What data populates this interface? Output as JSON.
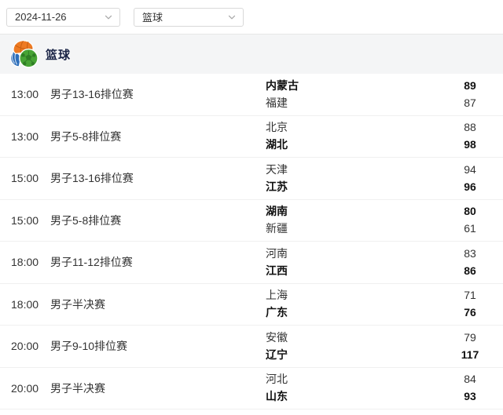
{
  "filters": {
    "date": {
      "value": "2024-11-26"
    },
    "sport": {
      "value": "篮球"
    }
  },
  "section": {
    "title": "篮球",
    "icon": "multi-sport-balls-logo"
  },
  "colors": {
    "title_navy": "#1a2446",
    "body_text": "#333333",
    "winner_text": "#111111",
    "divider": "#f0f0f0",
    "section_header_bg": "#f4f5f6",
    "select_border": "#d9d9d9",
    "logo_orange": "#ee7a22",
    "logo_blue": "#2e6fba",
    "logo_green": "#47a335"
  },
  "matches": [
    {
      "time": "13:00",
      "event": "男子13-16排位赛",
      "teams": [
        {
          "name": "内蒙古",
          "score": "89",
          "winner": true
        },
        {
          "name": "福建",
          "score": "87",
          "winner": false
        }
      ]
    },
    {
      "time": "13:00",
      "event": "男子5-8排位赛",
      "teams": [
        {
          "name": "北京",
          "score": "88",
          "winner": false
        },
        {
          "name": "湖北",
          "score": "98",
          "winner": true
        }
      ]
    },
    {
      "time": "15:00",
      "event": "男子13-16排位赛",
      "teams": [
        {
          "name": "天津",
          "score": "94",
          "winner": false
        },
        {
          "name": "江苏",
          "score": "96",
          "winner": true
        }
      ]
    },
    {
      "time": "15:00",
      "event": "男子5-8排位赛",
      "teams": [
        {
          "name": "湖南",
          "score": "80",
          "winner": true
        },
        {
          "name": "新疆",
          "score": "61",
          "winner": false
        }
      ]
    },
    {
      "time": "18:00",
      "event": "男子11-12排位赛",
      "teams": [
        {
          "name": "河南",
          "score": "83",
          "winner": false
        },
        {
          "name": "江西",
          "score": "86",
          "winner": true
        }
      ]
    },
    {
      "time": "18:00",
      "event": "男子半决赛",
      "teams": [
        {
          "name": "上海",
          "score": "71",
          "winner": false
        },
        {
          "name": "广东",
          "score": "76",
          "winner": true
        }
      ]
    },
    {
      "time": "20:00",
      "event": "男子9-10排位赛",
      "teams": [
        {
          "name": "安徽",
          "score": "79",
          "winner": false
        },
        {
          "name": "辽宁",
          "score": "117",
          "winner": true
        }
      ]
    },
    {
      "time": "20:00",
      "event": "男子半决赛",
      "teams": [
        {
          "name": "河北",
          "score": "84",
          "winner": false
        },
        {
          "name": "山东",
          "score": "93",
          "winner": true
        }
      ]
    }
  ]
}
